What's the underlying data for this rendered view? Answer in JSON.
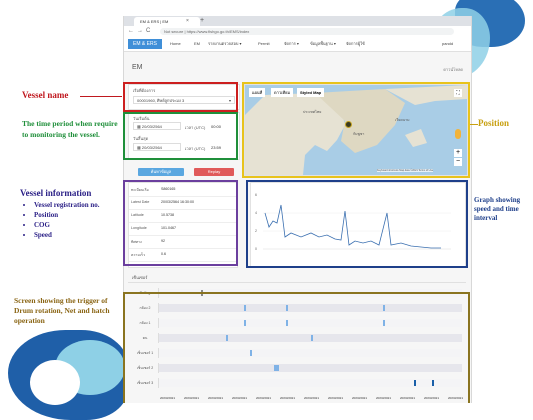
{
  "browser": {
    "tab_title": "EM & ERS | EM",
    "tab_close": "×",
    "tab_add": "+",
    "nav_back": "←",
    "nav_forward": "→",
    "nav_reload": "C",
    "url": "Not secure | https://www.fishgo.go.th/EMS/index"
  },
  "app": {
    "brand": "EM & ERS",
    "nav": [
      "Home",
      "EM",
      "รายงานตรวจสอบ ▾",
      "Permit",
      "จัดการ ▾",
      "ข้อมูลพื้นฐาน ▾",
      "จัดการผู้ใช้"
    ],
    "user": "pandd",
    "page_title": "EM",
    "pdf_link": "ดาวน์โหลด"
  },
  "vessel_select": {
    "label": "เรือที่ต้องการ",
    "value": "00001960, ศิษย์ลูกประมง 3"
  },
  "time_period": {
    "start_label": "วันเริ่มต้น",
    "start_date": "20/03/2564",
    "start_time_label": "เวลา (UTC)",
    "start_time": "00:00",
    "end_label": "วันสิ้นสุด",
    "end_date": "20/03/2564",
    "end_time_label": "เวลา (UTC)",
    "end_time": "23:59"
  },
  "buttons": {
    "search": "ค้นหาข้อมูล",
    "playback": "Replay"
  },
  "map": {
    "tabs": [
      "แผนที่",
      "ดาวเทียม",
      "Styled Map"
    ],
    "place_labels": [
      "ประเทศไทย",
      "กัมพูชา",
      "เวียดนาม"
    ],
    "zoom_in": "+",
    "zoom_out": "−",
    "fullscreen": "⛶",
    "attribution": "Keyboard shortcuts  Map data ©2021  Terms of Use"
  },
  "vessel_info": {
    "rows": [
      {
        "label": "ทะเบียนเรือ",
        "value": "S860165"
      },
      {
        "label": "Latest Date",
        "value": "20/03/2564 16:30:00"
      },
      {
        "label": "Latitude",
        "value": "10.5738"
      },
      {
        "label": "Longitude",
        "value": "101.0467"
      },
      {
        "label": "ทิศทาง",
        "value": "92"
      },
      {
        "label": "ความเร็ว",
        "value": "0.6"
      }
    ]
  },
  "speed_graph": {
    "y_ticks": [
      "6",
      "4",
      "2",
      "0"
    ]
  },
  "trigger": {
    "title": "เซ็นเซอร์",
    "rows": [
      {
        "label": "Rolling",
        "marks": [
          0.14
        ]
      },
      {
        "label": "กล้อง 2",
        "marks": [
          0.28,
          0.42,
          0.74
        ]
      },
      {
        "label": "กล้อง 1",
        "marks": [
          0.28,
          0.42,
          0.74
        ]
      },
      {
        "label": "คน",
        "marks": [
          0.22,
          0.5
        ]
      },
      {
        "label": "เซ็นเซอร์ 1",
        "marks": [
          0.3
        ]
      },
      {
        "label": "เซ็นเซอร์ 2",
        "marks": [
          0.38
        ]
      },
      {
        "label": "เซ็นเซอร์ 3",
        "marks": [
          0.84,
          0.9
        ]
      }
    ],
    "dates": [
      "20/03/2021",
      "20/03/2021",
      "20/03/2021",
      "20/03/2021",
      "20/03/2021",
      "20/03/2021",
      "20/03/2021",
      "20/03/2021",
      "20/03/2021",
      "20/03/2021",
      "20/03/2021",
      "20/03/2021",
      "20/03/2021"
    ]
  },
  "annotations": {
    "vessel_name": "Vessel name",
    "time_period": "The time period when require to monitoring the vessel.",
    "vessel_info_title": "Vessel information",
    "vessel_info_items": [
      "Vessel registration no.",
      "Position",
      "COG",
      "Speed"
    ],
    "position": "Position",
    "graph": "Graph showing speed and time interval",
    "trigger": "Screen showing the trigger of Drum rotation, Net and hatch operation"
  },
  "colors": {
    "red": "#cc1f1f",
    "green": "#1f8f3a",
    "purple": "#6b3f9e",
    "yellow": "#e8c31b",
    "navy": "#1e3f8a",
    "olive": "#8a7420",
    "annotation_text": "#2a1f86",
    "accent_blue": "#3f8fd8"
  }
}
